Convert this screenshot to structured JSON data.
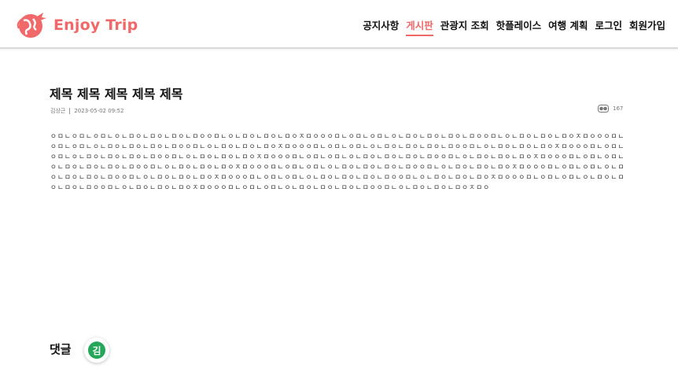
{
  "header": {
    "logo_text": "Enjoy Trip",
    "nav": [
      {
        "label": "공지사항",
        "active": false
      },
      {
        "label": "게시판",
        "active": true
      },
      {
        "label": "관광지 조회",
        "active": false
      },
      {
        "label": "핫플레이스",
        "active": false
      },
      {
        "label": "여행 계획",
        "active": false
      },
      {
        "label": "로그인",
        "active": false
      },
      {
        "label": "회원가입",
        "active": false
      }
    ]
  },
  "post": {
    "title": "제목 제목 제목 제목 제목",
    "author": "김상근",
    "date": "2023-05-02 09:52",
    "views": "167",
    "content": "ㅇㅁㄴㅇㅁㄴㅇㅁㄴㅇㄴㅁㅇㄴㅁㅇㄴㅁㅇㄴㅁㅇㅇㅁㄴㅇㄴㅁㅇㄴㅁㅇㄴㅁㅇㅈㅁㅇㅇㅇㅁㄴㅇㅁㄴㅇㅁㄴㅇㄴㅁㅇㄴㅁㅇㄴㅁㅇㄴㅁㅇㅇㅁㄴㅇㄴㅁㅇㄴㅁㅇㄴㅁㅇㅈㅁㅇㅇㅇㅁㄴㅇㅁㄴㅇㅁㄴㅇㄴㅁㅇㄴㅁㅇㄴㅁㅇㄴㅁㅇㅇㅁㄴㅇㄴㅁㅇㄴㅁㅇㄴㅁㅇㅈㅁㅇㅇㅇㅁㄴㅇㅁㄴㅇㅁㄴㅇㄴㅁㅇㄴㅁㅇㄴㅁㅇㄴㅁㅇㅇㅁㄴㅇㄴㅁㅇㄴㅁㅇㄴㅁㅇㅈㅁㅇㅇㅇㅁㄴㅇㅁㄴㅇㅁㄴㅇㄴㅁㅇㄴㅁㅇㄴㅁㅇㄴㅁㅇㅇㅁㄴㅇㄴㅁㅇㄴㅁㅇㄴㅁㅇㅈㅁㅇㅇㅇㅁㄴㅇㅁㄴㅇㅁㄴㅇㄴㅁㅇㄴㅁㅇㄴㅁㅇㄴㅁㅇㅇㅁㄴㅇㄴㅁㅇㄴㅁㅇㄴㅁㅇㅈㅁㅇㅇㅇㅁㄴㅇㅁㄴㅇㅁㄴㅇㄴㅁㅇㄴㅁㅇㄴㅁㅇㄴㅁㅇㅇㅁㄴㅇㄴㅁㅇㄴㅁㅇㄴㅁㅇㅈㅁㅇㅇㅇㅁㄴㅇㅁㄴㅇㅁㄴㅇㄴㅁㅇㄴㅁㅇㄴㅁㅇㄴㅁㅇㅇㅁㄴㅇㄴㅁㅇㄴㅁㅇㄴㅁㅇㅈㅁㅇㅇㅇㅁㄴㅇㅁㄴㅇㅁㄴㅇㄴㅁㅇㄴㅁㅇㄴㅁㅇㄴㅁㅇㅇㅁㄴㅇㄴㅁㅇㄴㅁㅇㄴㅁㅇㅈㅁㅇㅇㅇㅁㄴㅇㅁㄴㅇㅁㄴㅇㄴㅁㅇㄴㅁㅇㄴㅁㅇㄴㅁㅇㅇㅁㄴㅇㄴㅁㅇㄴㅁㅇㄴㅁㅇㅈㅁㅇㅇㅇㅁㄴㅇㅁㄴㅇㅁㄴㅇㄴㅁㅇㄴㅁㅇㄴㅁㅇㄴㅁㅇㅇㅁㄴㅇㄴㅁㅇㄴㅁㅇㄴㅁㅇㅈㅁㅇㅇㅇㅁㄴㅇㅁㄴㅇㅁㄴㅇㄴㅁㅇㄴㅁㅇㄴㅁㅇㄴㅁㅇㅇㅁㄴㅇㄴㅁㅇㄴㅁㅇㄴㅁㅇㅈㅁㅇ"
  },
  "comments": {
    "title": "댓글",
    "avatar_initial": "김"
  },
  "colors": {
    "brand": "#f0686a",
    "avatar_bg": "#25a75a"
  },
  "icons": {
    "logo": "globe-bird-logo-icon",
    "views": "eye-icon"
  }
}
